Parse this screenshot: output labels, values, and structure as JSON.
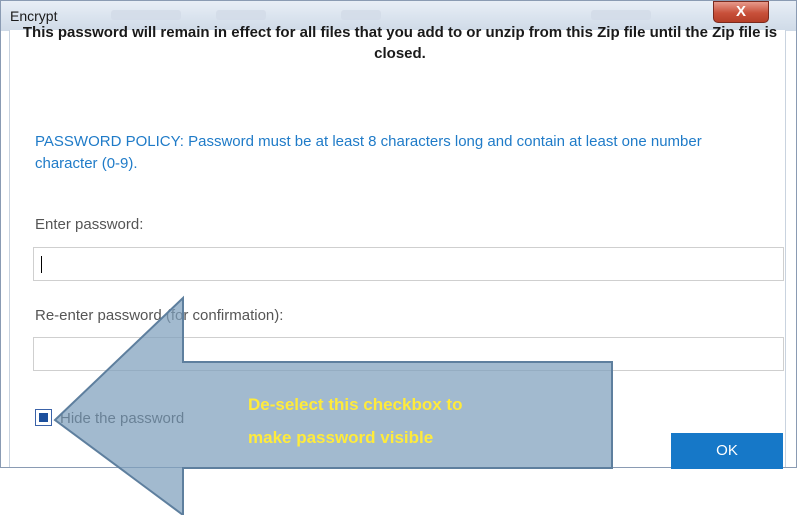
{
  "window": {
    "title": "Encrypt",
    "close_glyph": "X"
  },
  "dialog": {
    "heading": "This password will remain in effect for all files that you add to or unzip from this Zip file until the Zip file is closed.",
    "policy": "PASSWORD POLICY: Password must be at least 8 characters long and contain at least one number character (0-9).",
    "enter_label": "Enter password:",
    "enter_value": "",
    "reenter_label": "Re-enter password (for confirmation):",
    "reenter_value": "",
    "hide_label": "Hide the password",
    "hide_checked": true,
    "ok_label": "OK"
  },
  "annotation": {
    "line1": "De-select this checkbox to",
    "line2": "make password visible",
    "text_color": "#ffeb3b",
    "arrow_color": "#7e9fbd"
  },
  "colors": {
    "accent": "#1678c8",
    "policy_text": "#1f7bc8"
  }
}
